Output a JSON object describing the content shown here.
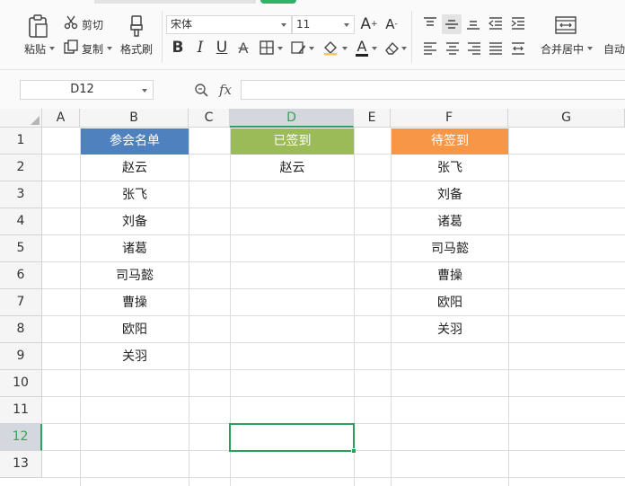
{
  "ribbon": {
    "paste_label": "粘贴",
    "cut_label": "剪切",
    "copy_label": "复制",
    "format_painter_label": "格式刷",
    "font_name": "宋体",
    "font_size": "11",
    "bold_glyph": "B",
    "italic_glyph": "I",
    "underline_glyph": "U",
    "font_color_glyph": "A",
    "merge_center_label": "合并居中",
    "autowrap_label": "自动",
    "accent_color": "#2fb366"
  },
  "formula_bar": {
    "name_box": "D12",
    "fx_label": "fx",
    "formula": ""
  },
  "grid": {
    "columns": [
      "A",
      "B",
      "C",
      "D",
      "E",
      "F",
      "G"
    ],
    "rows": [
      "1",
      "2",
      "3",
      "4",
      "5",
      "6",
      "7",
      "8",
      "9",
      "10",
      "11",
      "12",
      "13"
    ],
    "selected_column": "D",
    "selected_row": "12",
    "headers": {
      "b1": "参会名单",
      "d1": "已签到",
      "f1": "待签到"
    },
    "header_colors": {
      "b1": "#4e81bd",
      "d1": "#9bbb59",
      "f1": "#f79646"
    },
    "column_b": [
      "赵云",
      "张飞",
      "刘备",
      "诸葛",
      "司马懿",
      "曹操",
      "欧阳",
      "关羽"
    ],
    "column_d": [
      "赵云"
    ],
    "column_f": [
      "张飞",
      "刘备",
      "诸葛",
      "司马懿",
      "曹操",
      "欧阳",
      "关羽"
    ]
  }
}
